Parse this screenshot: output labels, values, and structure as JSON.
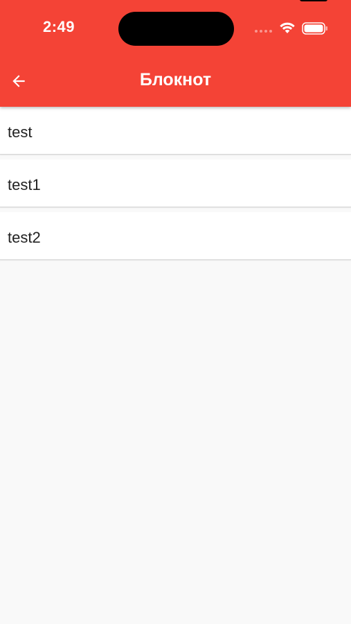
{
  "status_bar": {
    "time": "2:49"
  },
  "app_bar": {
    "title": "Блокнот",
    "back_icon": "arrow-left-icon",
    "background_color": "#f44336"
  },
  "notes": [
    {
      "label": "test"
    },
    {
      "label": "test1"
    },
    {
      "label": "test2"
    }
  ]
}
